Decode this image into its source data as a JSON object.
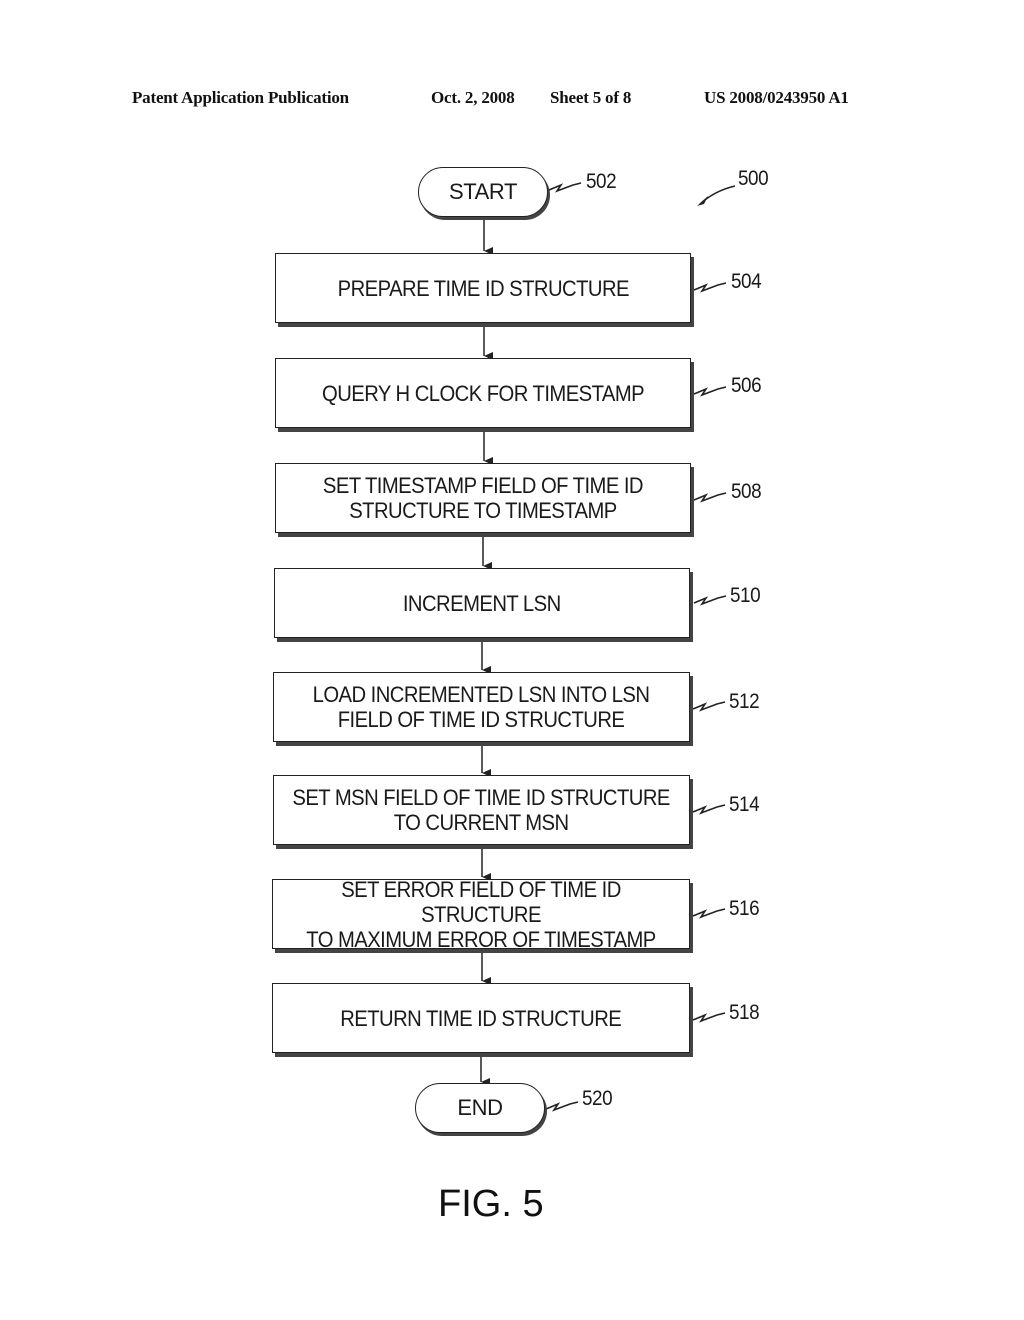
{
  "header": {
    "publication": "Patent Application Publication",
    "date": "Oct. 2, 2008",
    "sheet": "Sheet 5 of 8",
    "number": "US 2008/0243950 A1"
  },
  "figure": {
    "ref": "500",
    "caption": "FIG. 5"
  },
  "flowchart": {
    "start": {
      "label": "START",
      "ref": "502"
    },
    "steps": [
      {
        "label": "PREPARE TIME ID STRUCTURE",
        "ref": "504"
      },
      {
        "label": "QUERY H CLOCK FOR TIMESTAMP",
        "ref": "506"
      },
      {
        "label": "SET TIMESTAMP FIELD OF TIME ID\nSTRUCTURE TO TIMESTAMP",
        "ref": "508"
      },
      {
        "label": "INCREMENT LSN",
        "ref": "510"
      },
      {
        "label": "LOAD INCREMENTED LSN INTO LSN\nFIELD OF TIME ID STRUCTURE",
        "ref": "512"
      },
      {
        "label": "SET MSN FIELD OF TIME ID STRUCTURE\nTO CURRENT MSN",
        "ref": "514"
      },
      {
        "label": "SET ERROR FIELD OF TIME ID STRUCTURE\nTO MAXIMUM ERROR OF TIMESTAMP",
        "ref": "516"
      },
      {
        "label": "RETURN TIME ID STRUCTURE",
        "ref": "518"
      }
    ],
    "end": {
      "label": "END",
      "ref": "520"
    }
  }
}
